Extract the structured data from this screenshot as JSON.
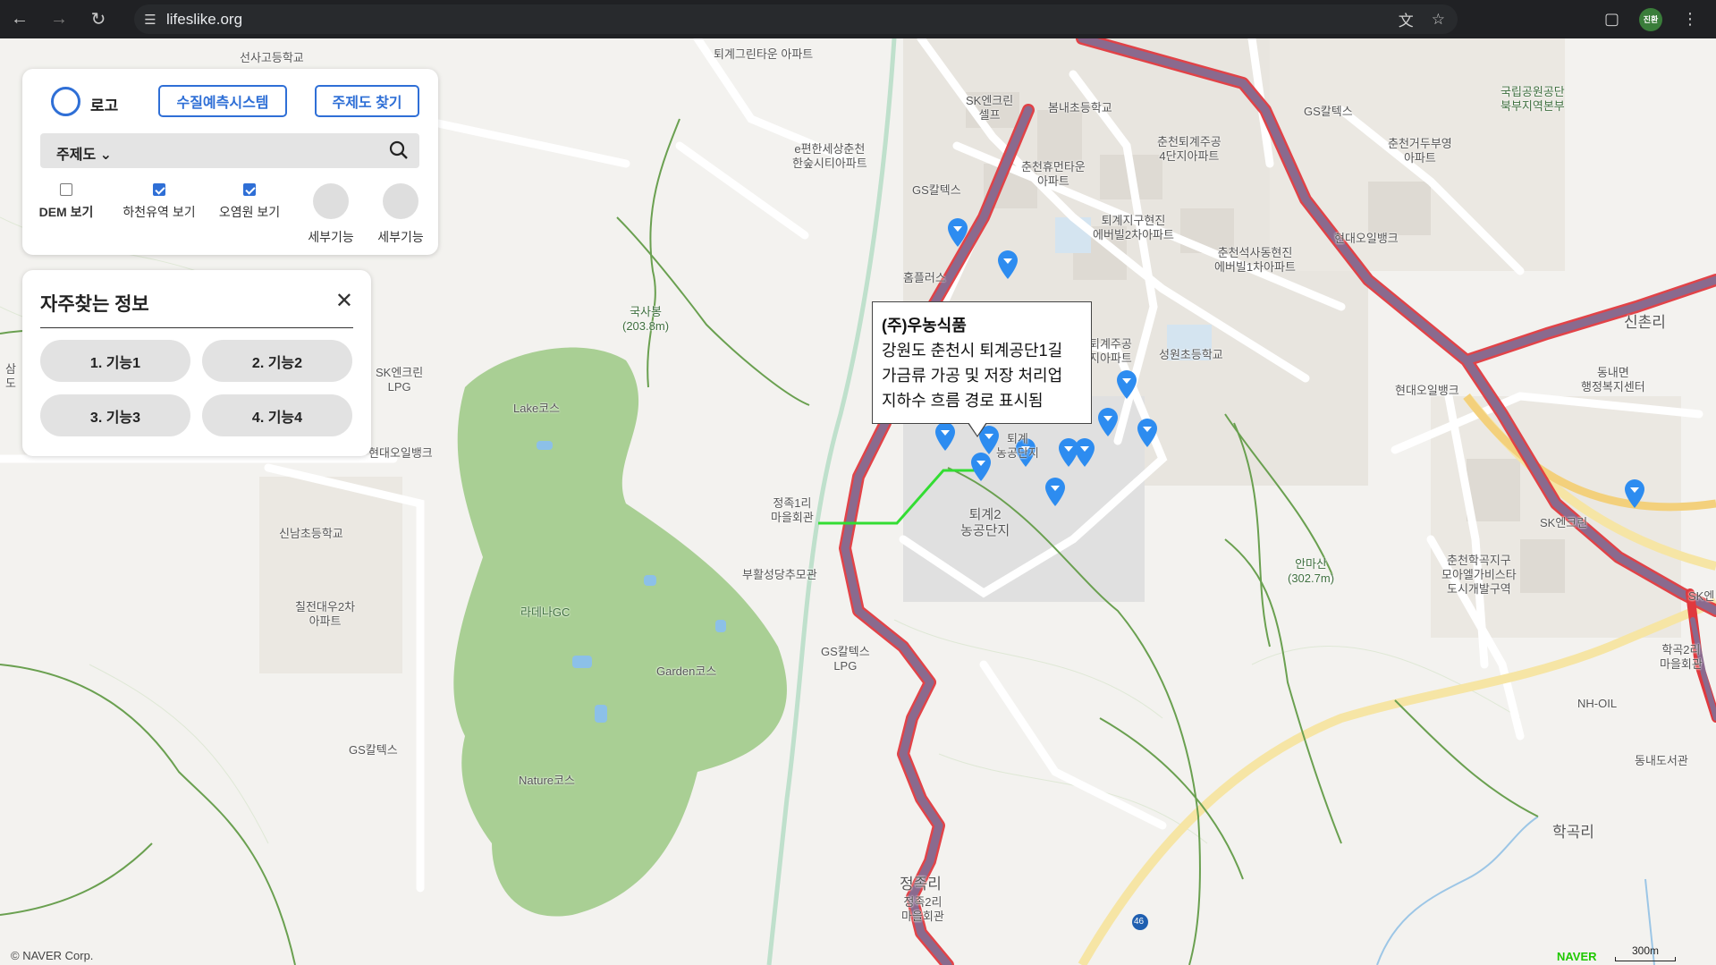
{
  "browser": {
    "url": "lifeslike.org",
    "profile_label": "진환"
  },
  "panel": {
    "logo_text": "로고",
    "btn_water": "수질예측시스템",
    "btn_theme": "주제도 찾기",
    "select_label": "주제도",
    "checks": [
      {
        "label": "DEM 보기",
        "checked": false
      },
      {
        "label": "하천유역 보기",
        "checked": true
      },
      {
        "label": "오염원 보기",
        "checked": true
      }
    ],
    "detail_1": "세부기능",
    "detail_2": "세부기능"
  },
  "frequent": {
    "title": "자주찾는 정보",
    "buttons": [
      "1. 기능1",
      "2. 기능2",
      "3. 기능3",
      "4. 기능4"
    ]
  },
  "popup": {
    "name": "(주)우농식품",
    "address": "강원도 춘천시 퇴계공단1길",
    "business": "가금류 가공 및 저장 처리업",
    "note": "지하수 흐름 경로 표시됨"
  },
  "map_labels": {
    "teogye_green": "퇴계그린타운\n아파트",
    "ehan": "e편한세상춘천\n한숲시티아파트",
    "sk_self": "SK엔크린\n셀프",
    "bomnae": "봄내초등학교",
    "chuncheon_teogye4": "춘천퇴계주공\n4단지아파트",
    "geodu": "춘천거두부영\n아파트",
    "gs_top": "GS칼텍스",
    "national_park": "국립공원공단\n북부지역본부",
    "hyumantown": "춘천휴먼타운\n아파트",
    "gs_mid": "GS칼텍스",
    "teogye_hyunjin": "퇴계지구현진\n에버빌2차아파트",
    "seoksa": "춘천석사동현진\n에버빌1차아파트",
    "hyundai_oil_top": "현대오일뱅크",
    "homeplus": "홈플러스",
    "guksa": "국사봉\n(203.8m)",
    "sinchon": "신촌리",
    "dongnae_office": "동내면\n행정복지센터",
    "hyundai_oil_right": "현대오일뱅크",
    "sk_lpg": "SK엔크린\nLPG",
    "seongwon": "성원초등학교",
    "teogye_jugong": "퇴계주공\n지아파트",
    "hyundai_oil_left": "현대오일뱅크",
    "lake": "Lake코스",
    "jeongjok1": "정족1리\n마을회관",
    "teogye2": "퇴계2\n농공단지",
    "teogye1": "퇴계\n농공단지",
    "sk_right": "SK엔크린",
    "anmasan": "안마산\n(302.7m)",
    "hakgok_district": "춘천학곡지구\n모아엘가비스타\n도시개발구역",
    "sinnam": "신남초등학교",
    "chiljeon": "칠전대우2차\n아파트",
    "buhwal": "부활성당추모관",
    "radena": "라데나GC",
    "gs_lpg": "GS칼텍스\nLPG",
    "garden": "Garden코스",
    "gs_left": "GS칼텍스",
    "nature": "Nature코스",
    "hakgok2": "학곡2리\n마을회관",
    "nh_oil": "NH-OIL",
    "dongnae_lib": "동내도서관",
    "hakgokri": "학곡리",
    "jeongjok2": "정족2리\n마을회관",
    "jeongjokri": "정족리",
    "road_46": "46",
    "sk_edge": "SK엔",
    "samcheon": "삼\n도",
    "seonsa": "선사고등학교"
  },
  "footer": {
    "credit": "© NAVER Corp.",
    "brand": "NAVER",
    "scale": "300m"
  },
  "colors": {
    "accent": "#2f6fd6",
    "watershed_red": "#e0393e",
    "flow_green": "#33dd33",
    "golf_green": "#a9cf94",
    "pin_blue": "#2d8cf0"
  }
}
